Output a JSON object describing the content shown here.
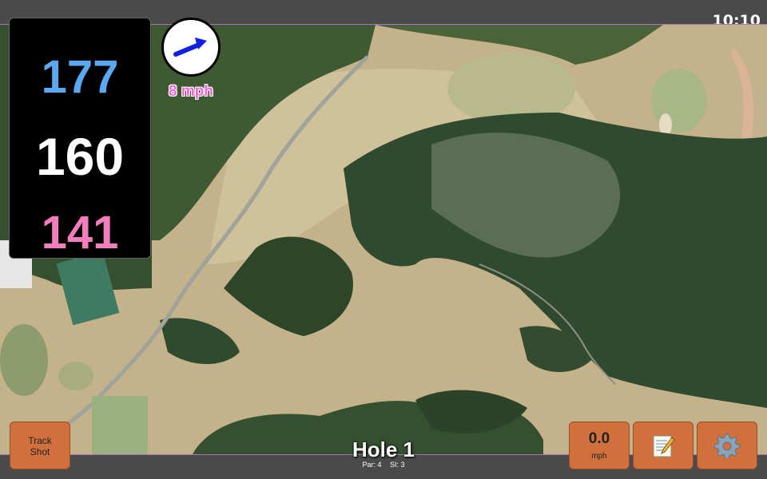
{
  "status_bar": {
    "clock": "10:10"
  },
  "distances": {
    "back": "177",
    "middle": "160",
    "front": "141"
  },
  "wind": {
    "speed_label": "8 mph",
    "direction_icon": "arrow-icon"
  },
  "hole": {
    "title": "Hole 1",
    "par_label": "Par: 4",
    "si_label": "SI: 3"
  },
  "buttons": {
    "track_shot_line1": "Track",
    "track_shot_line2": "Shot",
    "speed_value": "0.0",
    "speed_unit": "mph",
    "notes_icon": "notepad-icon",
    "settings_icon": "gear-icon"
  },
  "colors": {
    "back": "#5aa8f0",
    "middle": "#ffffff",
    "front": "#f47dbd",
    "wind_text": "#f06ad4",
    "button": "#d0703d"
  }
}
